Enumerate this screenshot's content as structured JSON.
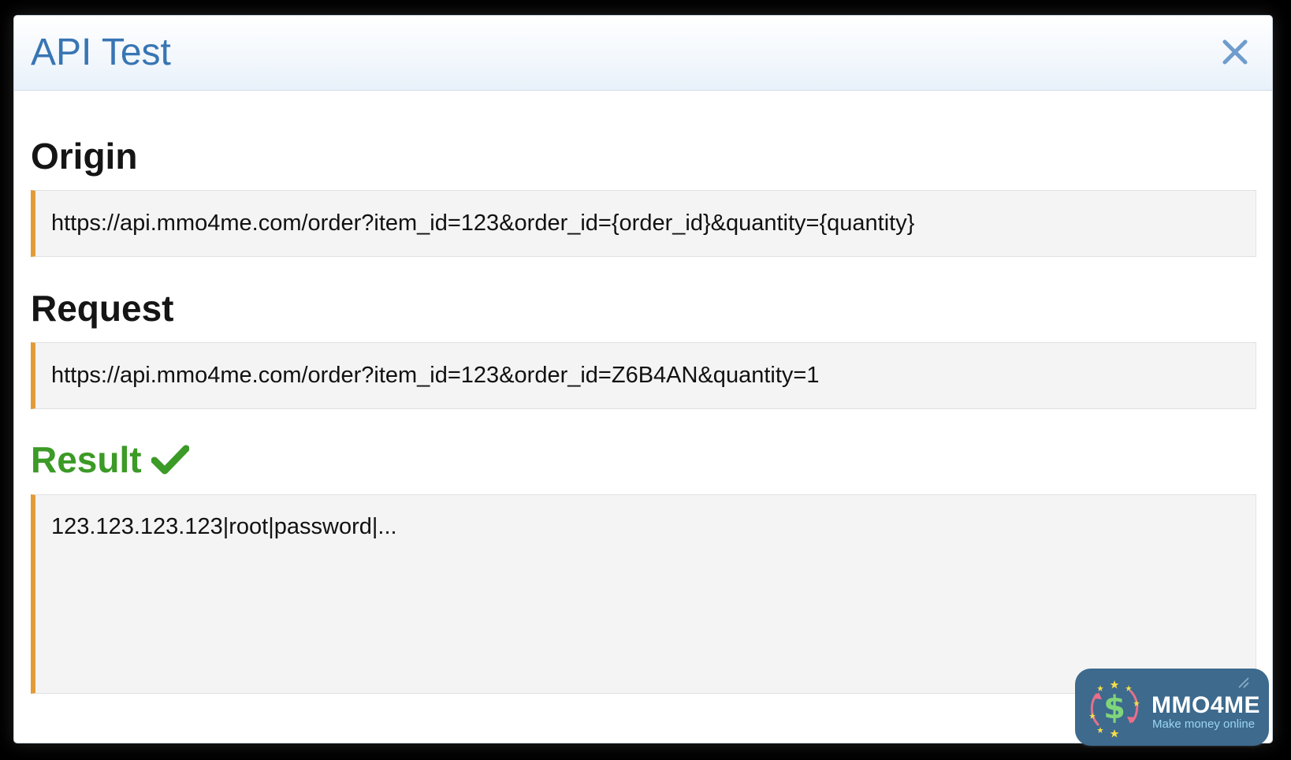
{
  "dialog": {
    "title": "API Test",
    "close_icon": "close-icon"
  },
  "origin": {
    "heading": "Origin",
    "value": "https://api.mmo4me.com/order?item_id=123&order_id={order_id}&quantity={quantity}"
  },
  "request": {
    "heading": "Request",
    "value": "https://api.mmo4me.com/order?item_id=123&order_id=Z6B4AN&quantity=1"
  },
  "result": {
    "heading": "Result",
    "status_icon": "checkmark-icon",
    "value": "123.123.123.123|root|password|..."
  },
  "watermark": {
    "name": "MMO4ME",
    "tagline": "Make money online"
  },
  "colors": {
    "title_blue": "#3875b4",
    "success_green": "#3c9a26",
    "accent_orange": "#e29b36",
    "code_background": "#f4f4f4",
    "logo_background": "#3d6a8d"
  }
}
